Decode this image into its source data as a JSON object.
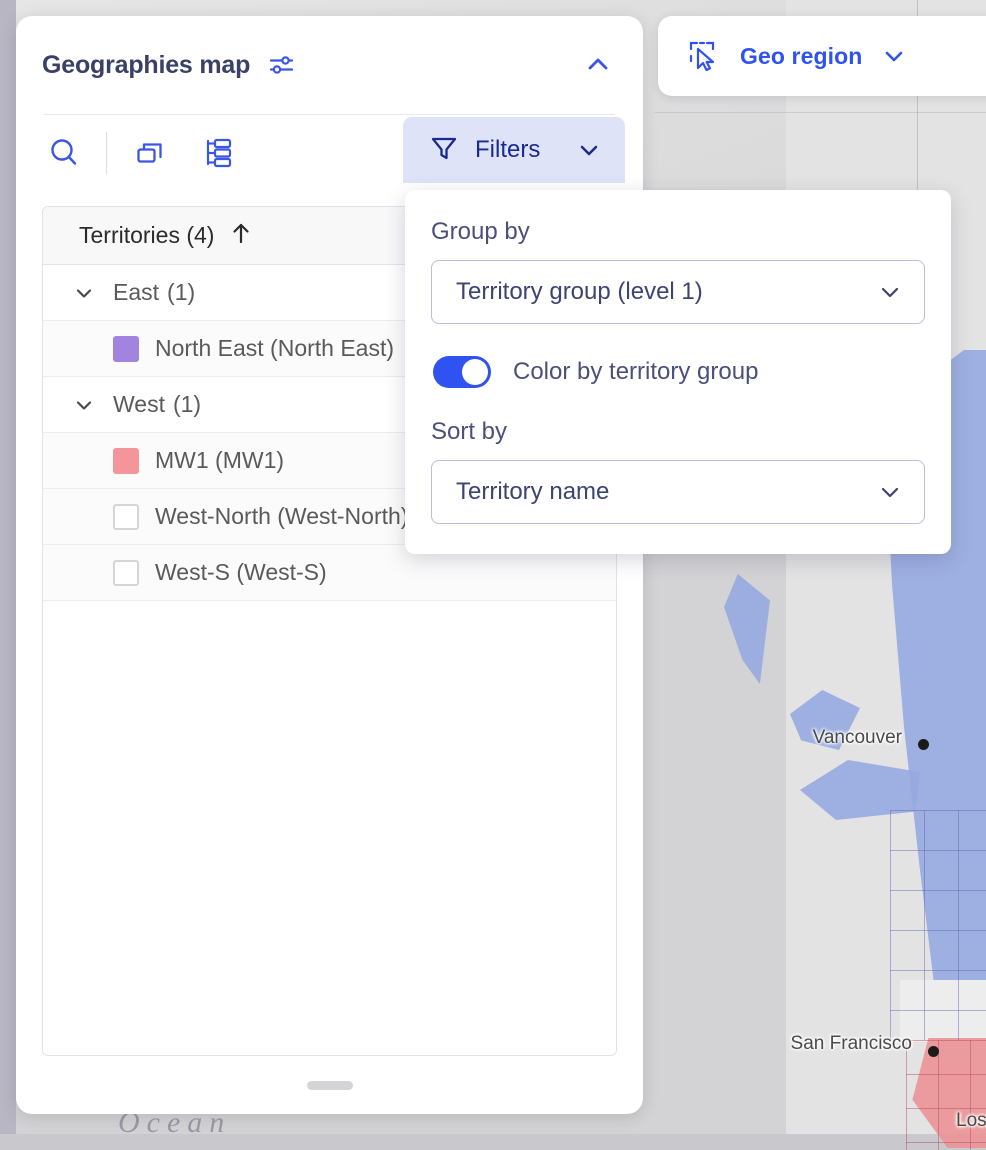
{
  "geo_region_bar": {
    "icon": "cursor-select-icon",
    "label": "Geo region",
    "caret": "chevron-down-icon"
  },
  "panel": {
    "title": "Geographies map",
    "title_settings_icon": "sliders-icon",
    "collapse_icon": "chevron-up-icon",
    "toolbar": {
      "search_icon": "search-icon",
      "duplicate_icon": "duplicate-layers-icon",
      "hierarchy_icon": "hierarchy-tree-icon",
      "filters_label": "Filters",
      "filters_icon": "funnel-icon",
      "filters_caret": "chevron-down-icon"
    },
    "list": {
      "header_label": "Territories (4)",
      "header_sort_icon": "arrow-up-icon",
      "rows": [
        {
          "type": "group",
          "label": "East",
          "count": "(1)",
          "marker": "chevron-down-icon"
        },
        {
          "type": "leaf",
          "label": "North East (North East)",
          "marker": "color-swatch",
          "color": "#a183e0"
        },
        {
          "type": "group",
          "label": "West",
          "count": "(1)",
          "marker": "chevron-down-icon"
        },
        {
          "type": "leaf",
          "label": "MW1 (MW1)",
          "marker": "color-swatch",
          "color": "#f4959a"
        },
        {
          "type": "leaf",
          "label": "West-North (West-North)",
          "marker": "checkbox-unchecked"
        },
        {
          "type": "leaf",
          "label": "West-S (West-S)",
          "marker": "checkbox-unchecked"
        }
      ]
    },
    "drag_handle": "resize-handle"
  },
  "filters_dropdown": {
    "group_by_label": "Group by",
    "group_by_value": "Territory group (level 1)",
    "toggle_label": "Color by territory group",
    "toggle_on": true,
    "sort_by_label": "Sort by",
    "sort_by_value": "Territory name",
    "caret_icon": "chevron-down-icon"
  },
  "map": {
    "cities": [
      {
        "name": "Vancouver"
      },
      {
        "name": "San Francisco"
      },
      {
        "name": "Los"
      }
    ],
    "ocean_label": "Ocean",
    "cursor_icon": "cursor-arrow-icon"
  },
  "colors": {
    "accent_blue": "#2f52f0",
    "navy": "#1a2a8f",
    "filters_bg": "#dfe3f7",
    "territory_purple": "#a183e0",
    "territory_salmon": "#f4959a",
    "map_region_blue": "#96a8e0",
    "map_region_red": "#eb9597"
  }
}
